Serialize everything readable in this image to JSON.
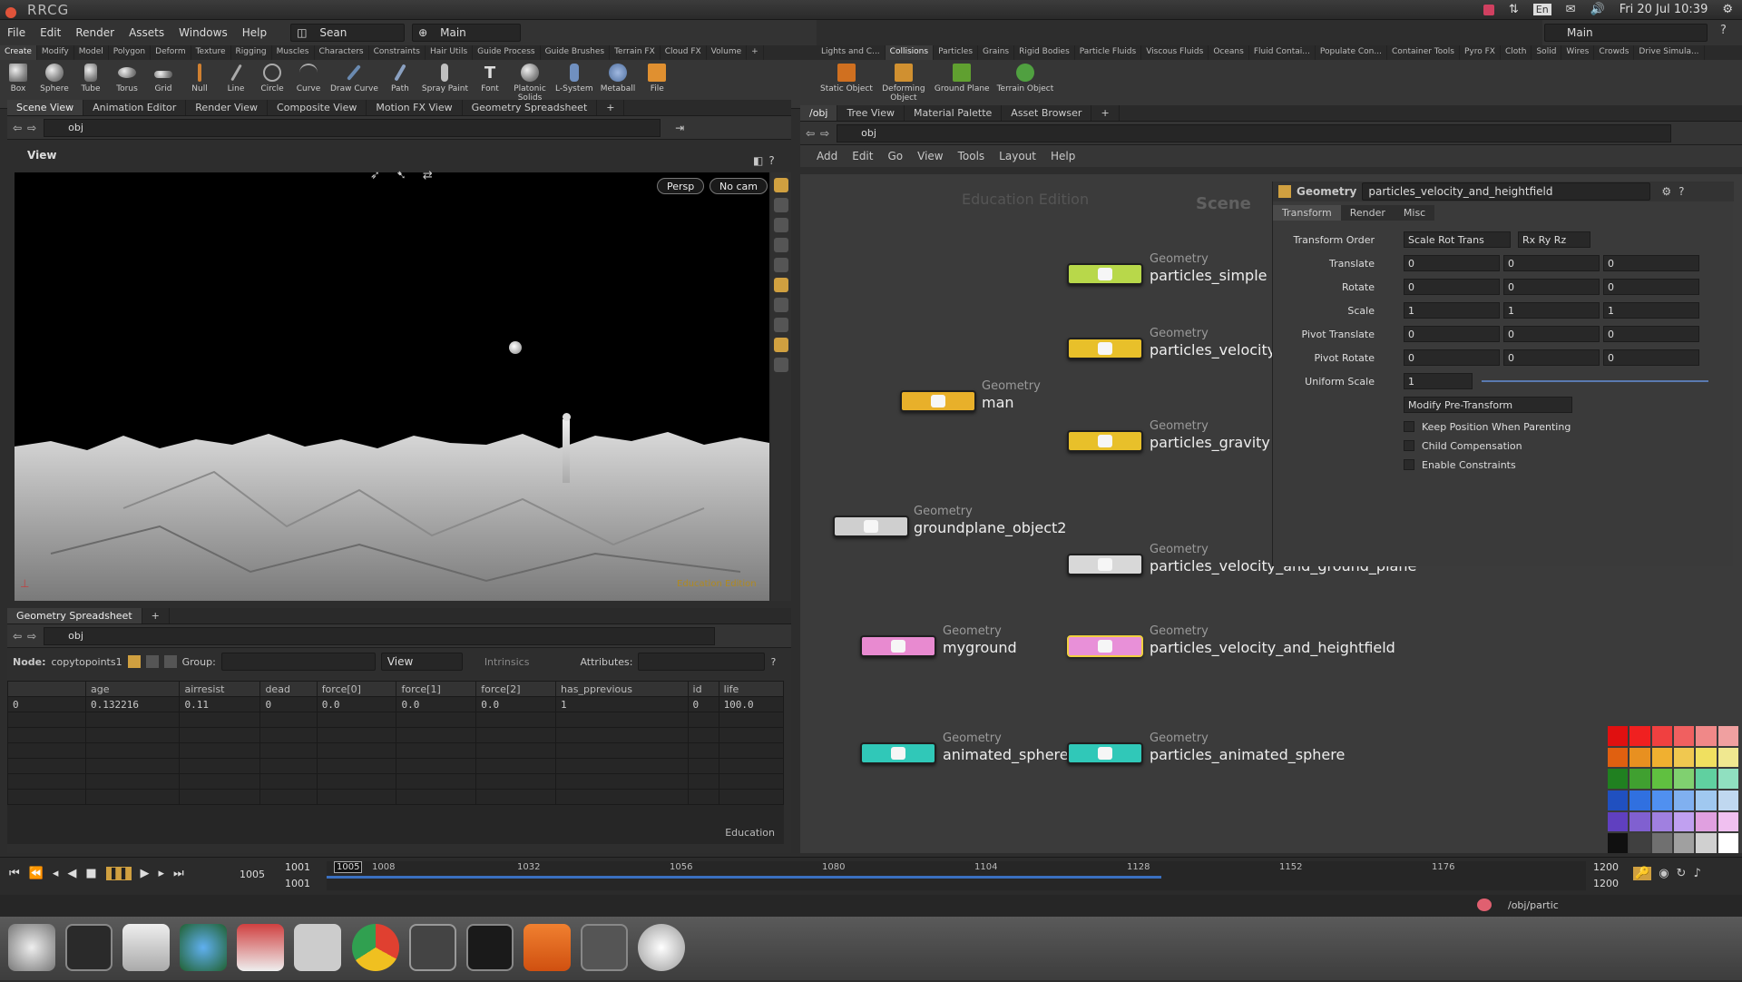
{
  "system": {
    "title": "RRCG",
    "datetime": "Fri 20 Jul 10:39",
    "lang": "En"
  },
  "menu": {
    "items": [
      "File",
      "Edit",
      "Render",
      "Assets",
      "Windows",
      "Help"
    ],
    "desktop": "Sean",
    "main": "Main",
    "right_main": "Main"
  },
  "shelf_left": {
    "tabs": [
      "Create",
      "Modify",
      "Model",
      "Polygon",
      "Deform",
      "Texture",
      "Rigging",
      "Muscles",
      "Characters",
      "Constraints",
      "Hair Utils",
      "Guide Process",
      "Guide Brushes",
      "Terrain FX",
      "Cloud FX",
      "Volume"
    ],
    "tools": [
      "Box",
      "Sphere",
      "Tube",
      "Torus",
      "Grid",
      "Null",
      "Line",
      "Circle",
      "Curve",
      "Draw Curve",
      "Path",
      "Spray Paint",
      "Font",
      "Platonic Solids",
      "L-System",
      "Metaball",
      "File"
    ]
  },
  "shelf_right": {
    "tabs": [
      "Lights and C...",
      "Collisions",
      "Particles",
      "Grains",
      "Rigid Bodies",
      "Particle Fluids",
      "Viscous Fluids",
      "Oceans",
      "Fluid Contai...",
      "Populate Con...",
      "Container Tools",
      "Pyro FX",
      "Cloth",
      "Solid",
      "Wires",
      "Crowds",
      "Drive Simula..."
    ],
    "tools": [
      "Static Object",
      "Deforming Object",
      "Ground Plane",
      "Terrain Object"
    ]
  },
  "scene_panel": {
    "tabs": [
      "Scene View",
      "Animation Editor",
      "Render View",
      "Composite View",
      "Motion FX View",
      "Geometry Spreadsheet"
    ],
    "path": "obj",
    "view_label": "View",
    "persp": "Persp",
    "cam": "No cam",
    "mode_label": "Education Edition"
  },
  "spreadsheet": {
    "tab": "Geometry Spreadsheet",
    "path": "obj",
    "node_label": "Node:",
    "node": "copytopoints1",
    "group_label": "Group:",
    "view": "View",
    "intrinsics": "Intrinsics",
    "attributes": "Attributes:",
    "footer": "Education",
    "columns": [
      "",
      "age",
      "airresist",
      "dead",
      "force[0]",
      "force[1]",
      "force[2]",
      "has_pprevious",
      "id",
      "life"
    ],
    "rows": [
      [
        "0",
        "0.132216",
        "0.11",
        "0",
        "0.0",
        "0.0",
        "0.0",
        "1",
        "0",
        "100.0"
      ]
    ]
  },
  "network_panel": {
    "tabs": [
      "/obj",
      "Tree View",
      "Material Palette",
      "Asset Browser"
    ],
    "path": "obj",
    "menu": [
      "Add",
      "Edit",
      "Go",
      "View",
      "Tools",
      "Layout",
      "Help"
    ],
    "watermark": "Education Edition",
    "scene_label": "Scene",
    "type_label": "Geometry",
    "nodes": [
      {
        "name": "particles_simple",
        "color": "#b8d84a"
      },
      {
        "name": "particles_velocity",
        "color": "#e8c02a"
      },
      {
        "name": "man",
        "color": "#e8b02a"
      },
      {
        "name": "particles_gravity",
        "color": "#e8c02a"
      },
      {
        "name": "groundplane_object2",
        "color": "#cfcfcf"
      },
      {
        "name": "particles_velocity_and_ground_plane",
        "color": "#d8d8d8"
      },
      {
        "name": "myground",
        "color": "#e88ad0"
      },
      {
        "name": "particles_velocity_and_heightfield",
        "color": "#e890d8"
      },
      {
        "name": "animated_sphere",
        "color": "#30c8b8"
      },
      {
        "name": "particles_animated_sphere",
        "color": "#30c8b8"
      }
    ]
  },
  "params": {
    "type": "Geometry",
    "node_name": "particles_velocity_and_heightfield",
    "tabs": [
      "Transform",
      "Render",
      "Misc"
    ],
    "transform_order_label": "Transform Order",
    "transform_order": "Scale Rot Trans",
    "rot_order": "Rx Ry Rz",
    "rows": [
      {
        "label": "Translate",
        "values": [
          "0",
          "0",
          "0"
        ]
      },
      {
        "label": "Rotate",
        "values": [
          "0",
          "0",
          "0"
        ]
      },
      {
        "label": "Scale",
        "values": [
          "1",
          "1",
          "1"
        ]
      },
      {
        "label": "Pivot Translate",
        "values": [
          "0",
          "0",
          "0"
        ]
      },
      {
        "label": "Pivot Rotate",
        "values": [
          "0",
          "0",
          "0"
        ]
      }
    ],
    "uniform_scale_label": "Uniform Scale",
    "uniform_scale": "1",
    "modify_pre": "Modify Pre-Transform",
    "checkboxes": [
      "Keep Position When Parenting",
      "Child Compensation",
      "Enable Constraints"
    ]
  },
  "timeline": {
    "start": "1001",
    "start2": "1001",
    "current": "1005",
    "current_box": "1005",
    "end": "1200",
    "end2": "1200",
    "ticks": [
      "1008",
      "1032",
      "1056",
      "1080",
      "1104",
      "1128",
      "1152",
      "1176"
    ],
    "path": "/obj/partic"
  },
  "palette": [
    "#e01010",
    "#f02020",
    "#f04040",
    "#f06060",
    "#f08888",
    "#f0a0a0",
    "#e06010",
    "#e89020",
    "#f0b030",
    "#f0c850",
    "#f0e060",
    "#f0e890",
    "#208020",
    "#40a030",
    "#60c040",
    "#80d070",
    "#60d0a0",
    "#90e0c0",
    "#2050c0",
    "#3070e0",
    "#5090f0",
    "#80b0f0",
    "#a0c8f0",
    "#c0d8f0",
    "#6040c0",
    "#8060d0",
    "#a080e0",
    "#c0a0f0",
    "#e0a0e0",
    "#f0c0f0",
    "#101010",
    "#404040",
    "#707070",
    "#a0a0a0",
    "#d0d0d0",
    "#ffffff"
  ]
}
